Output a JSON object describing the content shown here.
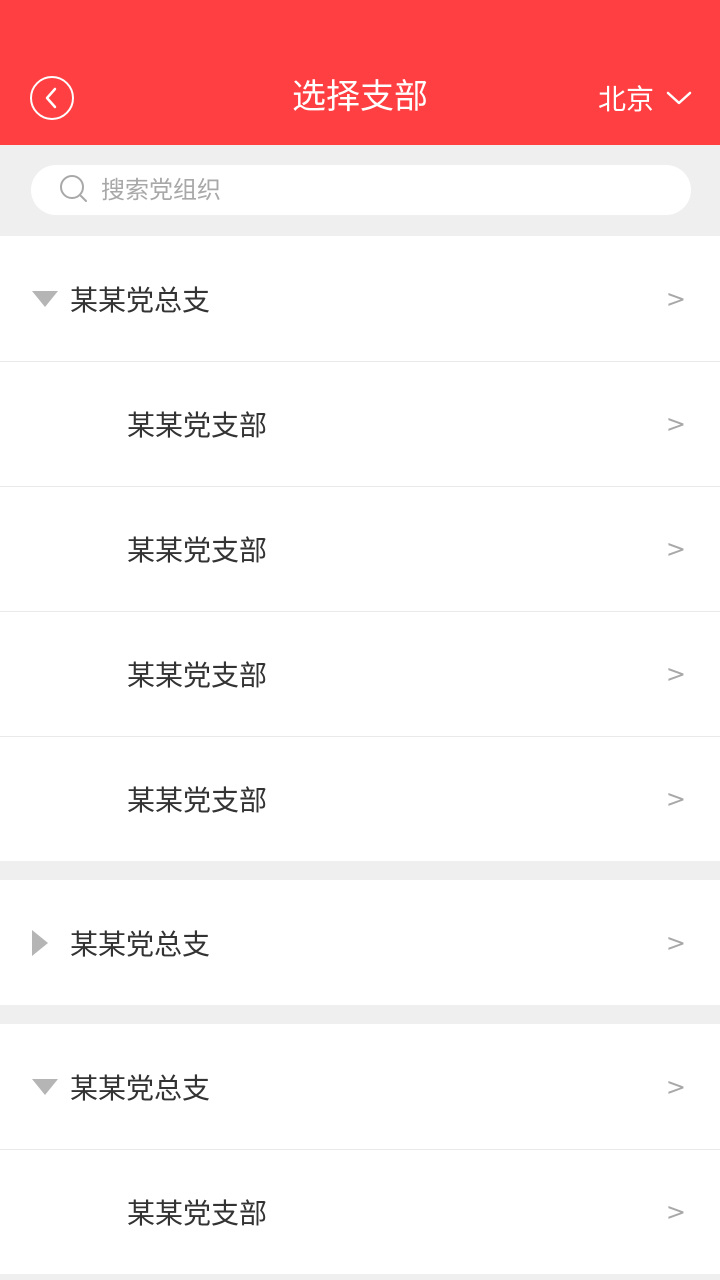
{
  "header": {
    "title": "选择支部",
    "city": "北京",
    "background": "#ff3f42"
  },
  "search": {
    "placeholder": "搜索党组织"
  },
  "groups": [
    {
      "name": "某某党总支",
      "expanded": true,
      "chevron": ">",
      "children": [
        {
          "name": "某某党支部",
          "chevron": ">"
        },
        {
          "name": "某某党支部",
          "chevron": ">"
        },
        {
          "name": "某某党支部",
          "chevron": ">"
        },
        {
          "name": "某某党支部",
          "chevron": ">"
        }
      ]
    },
    {
      "name": "某某党总支",
      "expanded": false,
      "chevron": ">",
      "children": []
    },
    {
      "name": "某某党总支",
      "expanded": true,
      "chevron": ">",
      "children": [
        {
          "name": "某某党支部",
          "chevron": ">"
        }
      ]
    }
  ],
  "icons": {
    "back": "chevron-left-circle-icon",
    "city_dropdown": "chevron-down-icon",
    "search": "search-icon",
    "expanded": "triangle-down-icon",
    "collapsed": "triangle-right-icon"
  }
}
